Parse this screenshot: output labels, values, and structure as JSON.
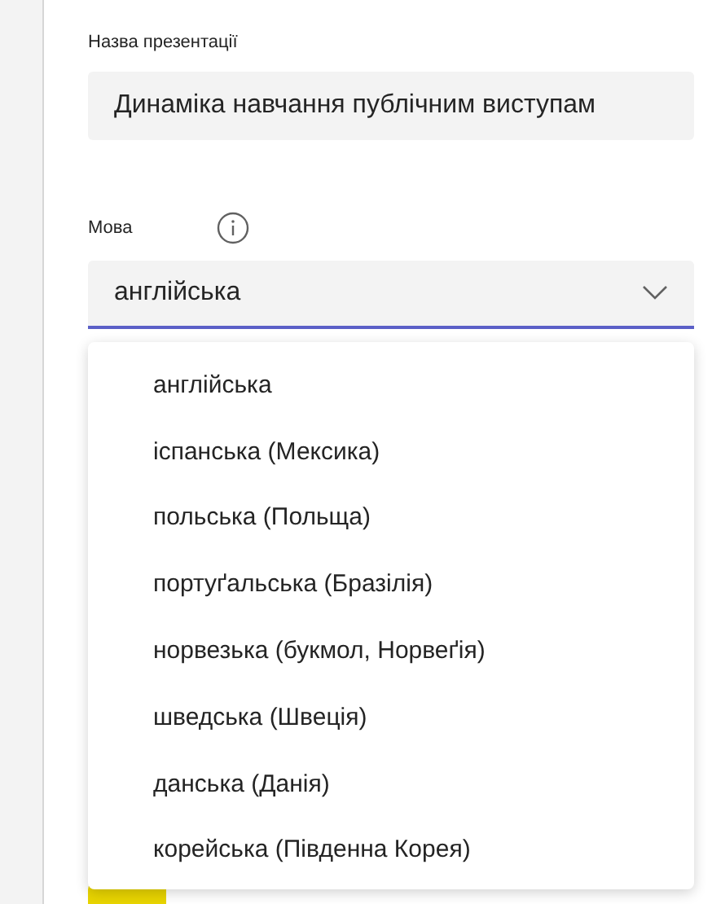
{
  "title_field": {
    "label": "Назва презентації",
    "value": "Динаміка навчання публічним виступам"
  },
  "language_field": {
    "label": "Мова",
    "value": "англійська",
    "expanded": true
  },
  "language_options": [
    {
      "label": "англійська"
    },
    {
      "label": "іспанська (Мексика)"
    },
    {
      "label": "польська (Польща)"
    },
    {
      "label": "портуґальська (Бразілія)"
    },
    {
      "label": "норвезька (букмол, Норвеґія)"
    },
    {
      "label": "шведська (Швеція)"
    },
    {
      "label": "данська (Данія)"
    },
    {
      "label": "корейська (Південна Корея)"
    }
  ]
}
